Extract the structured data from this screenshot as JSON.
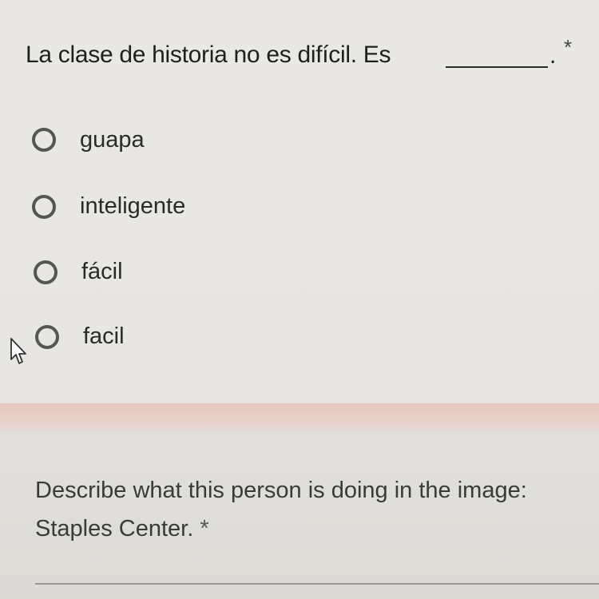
{
  "question1": {
    "title": "La clase de historia no es difícil. Es",
    "blank_end": ".",
    "required_mark": "*",
    "options": [
      {
        "label": "guapa"
      },
      {
        "label": "inteligente"
      },
      {
        "label": "fácil"
      },
      {
        "label": "facil"
      }
    ]
  },
  "question2": {
    "line1": "Describe what this person is doing in the image:",
    "line2": "Staples Center.",
    "required_mark": "*"
  },
  "icons": {
    "cursor": "mouse-pointer-icon",
    "radio": "radio-unchecked-icon"
  },
  "colors": {
    "background": "#e8e6e2",
    "text": "#1f1f1f",
    "radio_border": "#555555"
  }
}
